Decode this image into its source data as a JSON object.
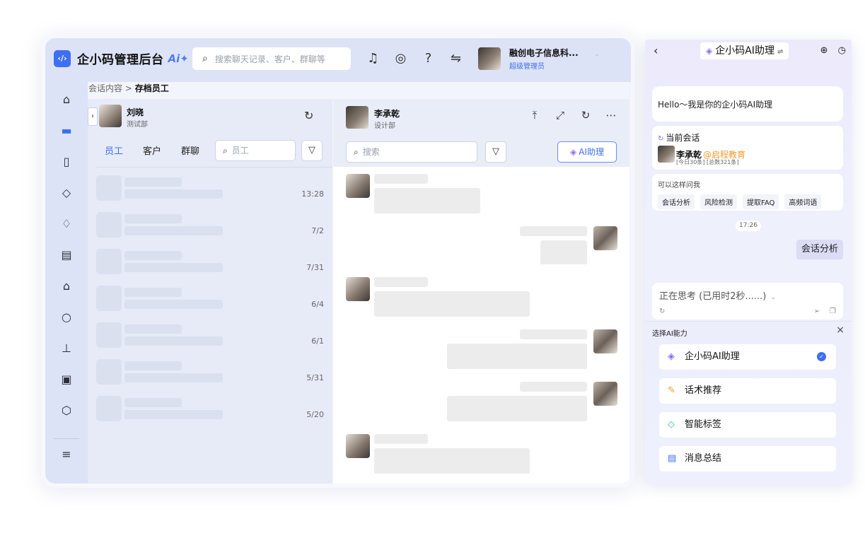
{
  "app": {
    "logo_glyph": "‹/›",
    "title": "企小码管理后台",
    "ai_badge": "Ai✦",
    "search_placeholder": "搜索聊天记录、客户、群聊等",
    "top_icons": [
      "bell-icon",
      "compass-icon",
      "help-icon",
      "switch-icon"
    ],
    "user": {
      "name": "融创电子信息科...",
      "role": "超级管理员"
    }
  },
  "sidebar": {
    "items": [
      "building-icon",
      "folder-icon",
      "book-icon",
      "shield-check-icon",
      "bell-user-icon",
      "document-user-icon",
      "chart-icon",
      "chat-icon",
      "org-chart-icon",
      "file-lock-icon",
      "settings-icon",
      "menu-expand-icon"
    ],
    "active_index": 1
  },
  "breadcrumb": {
    "parent": "会话内容",
    "separator": ">",
    "current": "存档员工"
  },
  "left_panel": {
    "employee": {
      "name": "刘晓",
      "dept": "测试部"
    },
    "tabs": [
      "员工",
      "客户",
      "群聊"
    ],
    "active_tab": 0,
    "search_placeholder": "员工",
    "rows": [
      {
        "time": "13:28"
      },
      {
        "time": "7/2"
      },
      {
        "time": "7/31"
      },
      {
        "time": "6/4"
      },
      {
        "time": "6/1"
      },
      {
        "time": "5/31"
      },
      {
        "time": "5/20"
      }
    ]
  },
  "chat": {
    "contact": {
      "name": "李承乾",
      "dept": "设计部"
    },
    "search_placeholder": "搜索",
    "ai_button": "AI助理"
  },
  "ai_panel": {
    "title": "企小码AI助理",
    "greeting": "Hello～我是你的企小码AI助理",
    "current_session_label": "当前会话",
    "session": {
      "name": "李承乾",
      "org": "@启程教育",
      "counts": "[今日30条] [总数321条]"
    },
    "ask_label": "可以这样问我",
    "suggestions": [
      "会话分析",
      "风险检测",
      "提取FAQ",
      "高频词语"
    ],
    "time": "17:26",
    "user_message": "会话分析",
    "thinking": "正在思考 (已用时2秒......)",
    "skills_title": "选择AI能力",
    "skills": [
      {
        "label": "企小码AI助理",
        "icon": "robot-icon",
        "selected": true
      },
      {
        "label": "话术推荐",
        "icon": "pen-icon",
        "selected": false
      },
      {
        "label": "智能标签",
        "icon": "tag-icon",
        "selected": false
      },
      {
        "label": "消息总结",
        "icon": "summary-icon",
        "selected": false
      }
    ]
  }
}
